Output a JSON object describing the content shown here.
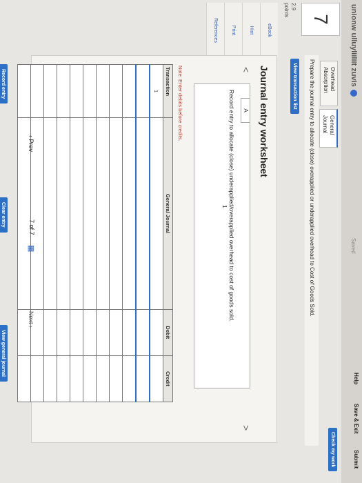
{
  "header": {
    "assignment": "unionw ulluyliiliit zuvis",
    "saved": "Saved",
    "help": "Help",
    "save_exit": "Save & Exit",
    "submit": "Submit",
    "check_my_work": "Check my work"
  },
  "question": {
    "number": "7",
    "points_value": "2.9",
    "points_label": "points"
  },
  "sidebar": {
    "items": [
      {
        "label": "eBook"
      },
      {
        "label": "Hint"
      },
      {
        "label": "Print"
      },
      {
        "label": "References"
      }
    ]
  },
  "tabs": [
    {
      "label": "Overhead Absorption"
    },
    {
      "label": "General Journal"
    }
  ],
  "prompt": "Prepare the journal entry to allocate (close) overapplied or underapplied overhead to Cost of Goods Sold.",
  "view_transaction_list": "View transaction list",
  "worksheet": {
    "title": "Journal entry worksheet",
    "prev_arrow": "<",
    "next_arrow": ">",
    "entry_tab": "A",
    "entry_text": "Record entry to allocate (close) underapplied/overapplied overhead to cost of goods sold.",
    "entry_number": "1",
    "note": "Note: Enter debits before credits.",
    "columns": [
      "Transaction",
      "General Journal",
      "Debit",
      "Credit"
    ],
    "rows": [
      [
        "1",
        "",
        "",
        ""
      ],
      [
        "",
        "",
        "",
        ""
      ],
      [
        "",
        "",
        "",
        ""
      ],
      [
        "",
        "",
        "",
        ""
      ],
      [
        "",
        "",
        "",
        ""
      ],
      [
        "",
        "",
        "",
        ""
      ],
      [
        "",
        "",
        "",
        ""
      ],
      [
        "",
        "",
        "",
        ""
      ],
      [
        "",
        "",
        "",
        ""
      ],
      [
        "",
        "",
        "",
        ""
      ],
      [
        "",
        "",
        "",
        ""
      ]
    ],
    "record_entry": "Record entry",
    "clear_entry": "Clear entry",
    "view_general_journal": "View general journal"
  },
  "footer": {
    "prev": "Prev",
    "page_current": "7",
    "page_sep": "of",
    "page_total": "7",
    "next": "Next"
  }
}
